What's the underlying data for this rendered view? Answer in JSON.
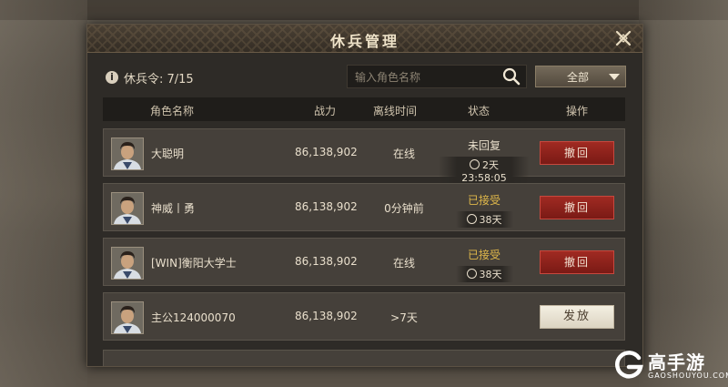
{
  "dialog": {
    "title": "休兵管理",
    "close_icon": "close-x-icon"
  },
  "info": {
    "icon": "info-icon",
    "icon_glyph": "i",
    "text": "休兵令: 7/15"
  },
  "search": {
    "placeholder": "输入角色名称",
    "icon": "search-icon"
  },
  "filter": {
    "selected": "全部",
    "icon": "chevron-down-icon"
  },
  "table": {
    "headers": {
      "name": "角色名称",
      "power": "战力",
      "offline": "离线时间",
      "status": "状态",
      "action": "操作"
    },
    "rows": [
      {
        "name": "大聪明",
        "power": "86,138,902",
        "offline": "在线",
        "status": "未回复",
        "status_type": "pending",
        "timer": "2天23:58:05",
        "action": "撤回"
      },
      {
        "name": "神威丨勇",
        "power": "86,138,902",
        "offline": "0分钟前",
        "status": "已接受",
        "status_type": "accepted",
        "timer": "38天",
        "action": "撤回"
      },
      {
        "name": "[WIN]衡阳大学士",
        "power": "86,138,902",
        "offline": "在线",
        "status": "已接受",
        "status_type": "accepted",
        "timer": "38天",
        "action": "撤回"
      },
      {
        "name": "主公124000070",
        "power": "86,138,902",
        "offline": ">7天",
        "status": "",
        "status_type": "none",
        "timer": "",
        "action": "发放"
      }
    ]
  },
  "watermark": {
    "brand": "高手游",
    "domain": "GAOSHOUYOU.COM"
  },
  "colors": {
    "recall_button": "#8e231c",
    "release_button": "#ece6d7",
    "accepted_status": "#e0b84a",
    "panel_bg": "#2e2b27"
  }
}
